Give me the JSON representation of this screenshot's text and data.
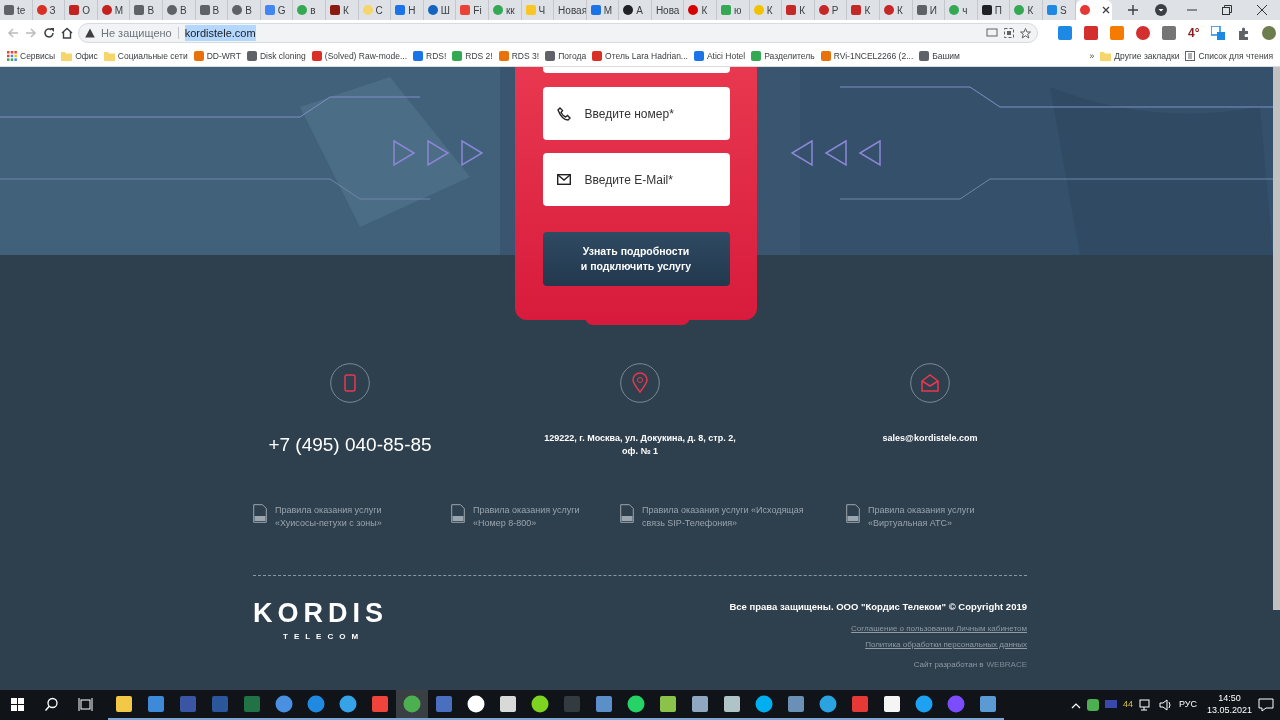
{
  "tabs": [
    {
      "label": "te",
      "color": "#5f6368",
      "selected": false
    },
    {
      "label": "З",
      "color": "#d93025",
      "selected": false
    },
    {
      "label": "О",
      "color": "#c5221f",
      "selected": false
    },
    {
      "label": "М",
      "color": "#c5221f",
      "selected": false
    },
    {
      "label": "В",
      "color": "#5f6368",
      "selected": false
    },
    {
      "label": "В",
      "color": "#5f6368",
      "selected": false
    },
    {
      "label": "В",
      "color": "#5f6368",
      "selected": false
    },
    {
      "label": "В",
      "color": "#5f6368",
      "selected": false
    },
    {
      "label": "G",
      "color": "#4285f4",
      "selected": false
    },
    {
      "label": "в",
      "color": "#34a853",
      "selected": false
    },
    {
      "label": "К",
      "color": "#8b1a10",
      "selected": false
    },
    {
      "label": "С",
      "color": "#f6d56a",
      "selected": false
    },
    {
      "label": "Н",
      "color": "#1a73e8",
      "selected": false
    },
    {
      "label": "Ш",
      "color": "#1565c0",
      "selected": false
    },
    {
      "label": "Fi",
      "color": "#ea4335",
      "selected": false
    },
    {
      "label": "кк",
      "color": "#34a853",
      "selected": false
    },
    {
      "label": "Ч",
      "color": "#f9c623",
      "selected": false
    },
    {
      "label": "Новая",
      "selected": false
    },
    {
      "label": "M",
      "color": "#1a73e8",
      "selected": false
    },
    {
      "label": "A",
      "color": "#202124",
      "selected": false
    },
    {
      "label": "Нова",
      "selected": false
    },
    {
      "label": "К",
      "color": "#d50000",
      "selected": false
    },
    {
      "label": "ю",
      "color": "#34a853",
      "selected": false
    },
    {
      "label": "К",
      "color": "#f2c200",
      "selected": false
    },
    {
      "label": "К",
      "color": "#c62828",
      "selected": false
    },
    {
      "label": "Р",
      "color": "#c62828",
      "selected": false
    },
    {
      "label": "К",
      "color": "#c62828",
      "selected": false
    },
    {
      "label": "К",
      "color": "#c62828",
      "selected": false
    },
    {
      "label": "И",
      "color": "#5f6368",
      "selected": false
    },
    {
      "label": "ч",
      "color": "#34a853",
      "selected": false
    },
    {
      "label": "П",
      "color": "#202124",
      "selected": false
    },
    {
      "label": "К",
      "color": "#34a853",
      "selected": false
    },
    {
      "label": "S",
      "color": "#1e88e5",
      "selected": false
    },
    {
      "color": "#e53935",
      "selected": true
    }
  ],
  "address_bar": {
    "security": "Не защищено",
    "url": "kordistele.com",
    "url_selected": true
  },
  "weather": "4°",
  "bookmarks": [
    {
      "kind": "apps",
      "label": "Сервисы"
    },
    {
      "kind": "folder",
      "label": "Офис"
    },
    {
      "kind": "folder",
      "label": "Социальные сети"
    },
    {
      "kind": "site",
      "label": "DD-WRT"
    },
    {
      "kind": "site",
      "label": "Disk cloning"
    },
    {
      "kind": "site",
      "label": "(Solved) Raw-mode..."
    },
    {
      "kind": "site",
      "label": "RDS!"
    },
    {
      "kind": "site",
      "label": "RDS 2!"
    },
    {
      "kind": "site",
      "label": "RDS 3!"
    },
    {
      "kind": "site",
      "label": "Погода"
    },
    {
      "kind": "site",
      "label": "Отель Lara Hadrian..."
    },
    {
      "kind": "site",
      "label": "Atici Hotel"
    },
    {
      "kind": "site",
      "label": "Разделитель"
    },
    {
      "kind": "site",
      "label": "RVi-1NCEL2266 (2..."
    },
    {
      "kind": "site",
      "label": "Башим"
    }
  ],
  "bookmarks_overflow": "»",
  "other_bookmarks": "Другие закладки",
  "reading_list": "Список для чтения",
  "form": {
    "fields": [
      {
        "kind": "phone",
        "placeholder": "Введите номер*"
      },
      {
        "kind": "email",
        "placeholder": "Введите E-Mail*"
      }
    ],
    "submit": "Узнать подробности\nи подключить услугу"
  },
  "contacts": [
    {
      "kind": "phone",
      "text": "+7 (495) 040-85-85"
    },
    {
      "kind": "address",
      "text": "129222, г. Москва, ул. Докукина, д. 8, стр. 2,\nоф. № 1"
    },
    {
      "kind": "email",
      "text": "sales@kordistele.com"
    }
  ],
  "documents": [
    "Правила оказания услуги\n«Хуисосы-петухи с зоны»",
    "Правила оказания услуги\n«Номер 8-800»",
    "Правила оказания услуги «Исходящая\nсвязь SIP-Телефония»",
    "Правила оказания услуги\n«Виртуальная АТС»"
  ],
  "footer": {
    "logo": "KORDIS",
    "logo_sub": "TELECOM",
    "copyright": "Все права защищены. ООО \"Кордис Телеком\" © Copyright 2019",
    "links": [
      "Соглашение о пользовании Личным кабинетом",
      "Политика обработки персональных данных"
    ],
    "credit": "Сайт разработан в",
    "credit_link": "WEBRACE"
  },
  "taskbar": {
    "apps": [
      {
        "kind": "folder",
        "active": false
      },
      {
        "kind": "mail",
        "active": false
      },
      {
        "kind": "visio",
        "active": false
      },
      {
        "kind": "word",
        "active": false
      },
      {
        "kind": "excel",
        "active": false
      },
      {
        "kind": "globe",
        "active": false
      },
      {
        "kind": "edge",
        "active": false
      },
      {
        "kind": "ie",
        "active": false
      },
      {
        "kind": "anydesk",
        "active": false
      },
      {
        "kind": "chrome",
        "active": true
      },
      {
        "kind": "network",
        "active": false
      },
      {
        "kind": "yandex",
        "active": false
      },
      {
        "kind": "vnc",
        "active": false
      },
      {
        "kind": "icq",
        "active": false
      },
      {
        "kind": "terminal",
        "active": false
      },
      {
        "kind": "remote",
        "active": false
      },
      {
        "kind": "whatsapp",
        "active": false
      },
      {
        "kind": "sheet",
        "active": false
      },
      {
        "kind": "computer",
        "active": false
      },
      {
        "kind": "window",
        "active": false
      },
      {
        "kind": "skype",
        "active": false
      },
      {
        "kind": "calculator",
        "active": false
      },
      {
        "kind": "telegram",
        "active": false
      },
      {
        "kind": "acrobat",
        "active": false
      },
      {
        "kind": "pdf",
        "active": false
      },
      {
        "kind": "twitter",
        "active": false
      },
      {
        "kind": "messenger",
        "active": false
      },
      {
        "kind": "screen",
        "active": false
      }
    ],
    "tray_count": "44",
    "language": "РУС",
    "time": "14:50",
    "date": "13.05.2021"
  }
}
